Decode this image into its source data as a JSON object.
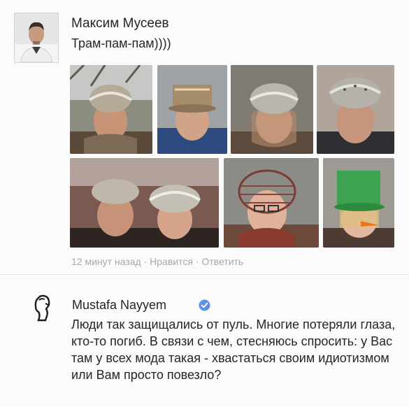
{
  "post": {
    "author": "Максим Мусеев",
    "text": "Трам-пам-пам))))",
    "avatar_icon": "user-photo",
    "photos": [
      {
        "label": "man-colander-1"
      },
      {
        "label": "man-pot-hat"
      },
      {
        "label": "old-woman-colander"
      },
      {
        "label": "old-man-colander"
      },
      {
        "label": "two-men-colanders"
      },
      {
        "label": "woman-wire-basket"
      },
      {
        "label": "woman-green-bucket"
      }
    ],
    "meta": {
      "time": "12 минут назад",
      "sep1": " · ",
      "like": "Нравится",
      "sep2": " · ",
      "reply": "Ответить"
    }
  },
  "reply": {
    "author": "Mustafa Nayyem",
    "verified_icon": "verified-check-icon",
    "logo_icon": "profile-silhouette-icon",
    "text": "Люди так защищались от пуль. Многие потеряли глаза, кто-то погиб. В связи с чем, стесняюсь спросить: у Вас там у всех мода такая - хвастаться своим идиотизмом или Вам просто повезло?"
  },
  "colors": {
    "accent": "#5b92e5",
    "meta_text": "#a5a8ad",
    "text": "#262626"
  }
}
